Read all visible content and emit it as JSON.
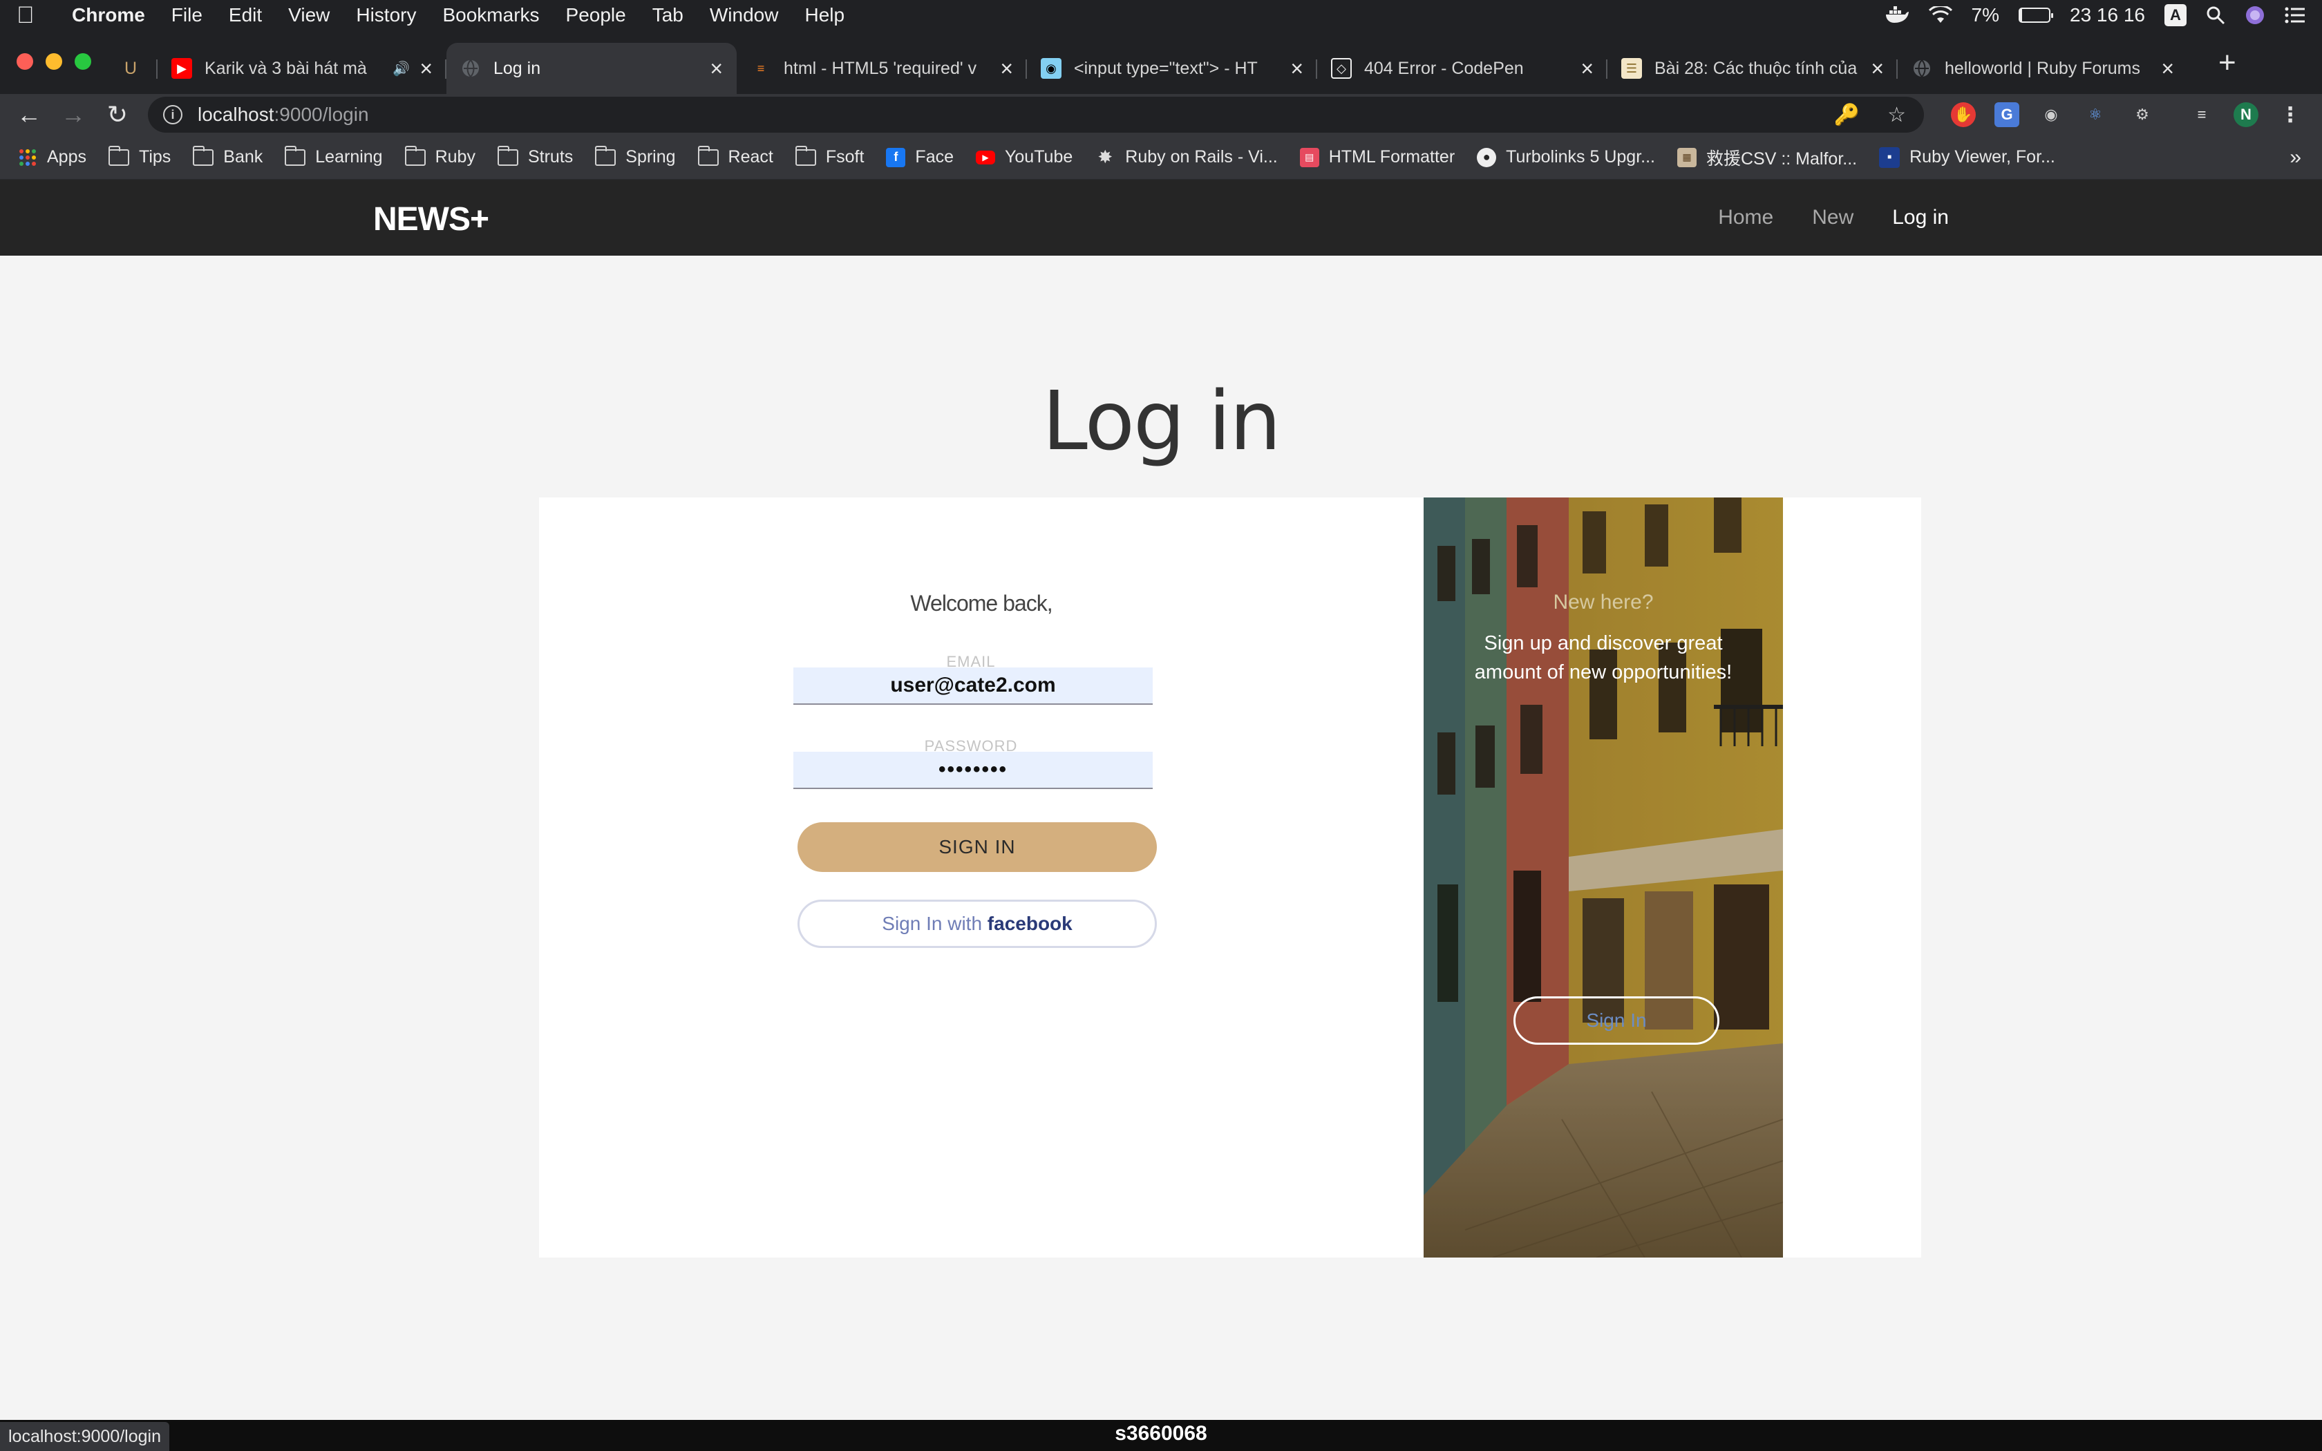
{
  "menubar": {
    "app": "Chrome",
    "items": [
      "File",
      "Edit",
      "View",
      "History",
      "Bookmarks",
      "People",
      "Tab",
      "Window",
      "Help"
    ],
    "battery": "7%",
    "battery_level": 0.07,
    "clock": "23 16 16",
    "input_source": "A"
  },
  "tabs": [
    {
      "title": "U",
      "favicon": "udemy-icon",
      "active": false
    },
    {
      "title": "Karik và 3 bài hát mà",
      "favicon": "youtube-icon",
      "active": false,
      "audio": true
    },
    {
      "title": "Log in",
      "favicon": "globe-icon",
      "active": true
    },
    {
      "title": "html - HTML5 'required' v",
      "favicon": "stackoverflow-icon",
      "active": false
    },
    {
      "title": "<input type=\"text\"> - HT",
      "favicon": "mdn-icon",
      "active": false
    },
    {
      "title": "404 Error - CodePen",
      "favicon": "codepen-icon",
      "active": false
    },
    {
      "title": "Bài 28: Các thuộc tính của",
      "favicon": "doc-icon",
      "active": false
    },
    {
      "title": "helloworld | Ruby Forums",
      "favicon": "globe-icon",
      "active": false
    }
  ],
  "omnibox": {
    "host": "localhost",
    "path": ":9000/login"
  },
  "toolbar": {
    "avatar": "N"
  },
  "bookmarks": [
    {
      "label": "Apps",
      "icon": "apps-icon"
    },
    {
      "label": "Tips",
      "icon": "folder-icon"
    },
    {
      "label": "Bank",
      "icon": "folder-icon"
    },
    {
      "label": "Learning",
      "icon": "folder-icon"
    },
    {
      "label": "Ruby",
      "icon": "folder-icon"
    },
    {
      "label": "Struts",
      "icon": "folder-icon"
    },
    {
      "label": "Spring",
      "icon": "folder-icon"
    },
    {
      "label": "React",
      "icon": "folder-icon"
    },
    {
      "label": "Fsoft",
      "icon": "folder-icon"
    },
    {
      "label": "Face",
      "icon": "facebook-icon"
    },
    {
      "label": "YouTube",
      "icon": "youtube-icon"
    },
    {
      "label": "Ruby on Rails - Vi...",
      "icon": "rails-icon"
    },
    {
      "label": "HTML Formatter",
      "icon": "formatter-icon"
    },
    {
      "label": "Turbolinks 5 Upgr...",
      "icon": "github-icon"
    },
    {
      "label": "救援CSV :: Malfor...",
      "icon": "csv-icon"
    },
    {
      "label": "Ruby Viewer, For...",
      "icon": "codebeautify-icon"
    }
  ],
  "site": {
    "brand": "NEWS+",
    "nav": [
      {
        "label": "Home",
        "active": false
      },
      {
        "label": "New",
        "active": false
      },
      {
        "label": "Log in",
        "active": true
      }
    ]
  },
  "login": {
    "page_title": "Log in",
    "welcome": "Welcome back,",
    "email_label": "EMAIL",
    "email_value": "user@cate2.com",
    "password_label": "PASSWORD",
    "password_value": "••••••••",
    "signin_button": "SIGN IN",
    "facebook_prefix": "Sign In with ",
    "facebook_brand": "facebook"
  },
  "promo": {
    "heading": "New here?",
    "text": "Sign up and discover great amount of new opportunities!",
    "button": "Sign In"
  },
  "status": {
    "hover_url": "localhost:9000/login",
    "bottom_label": "s3660068"
  },
  "colors": {
    "signin_button": "#d4af7e",
    "site_nav": "#252525",
    "page_bg": "#f4f4f4"
  }
}
